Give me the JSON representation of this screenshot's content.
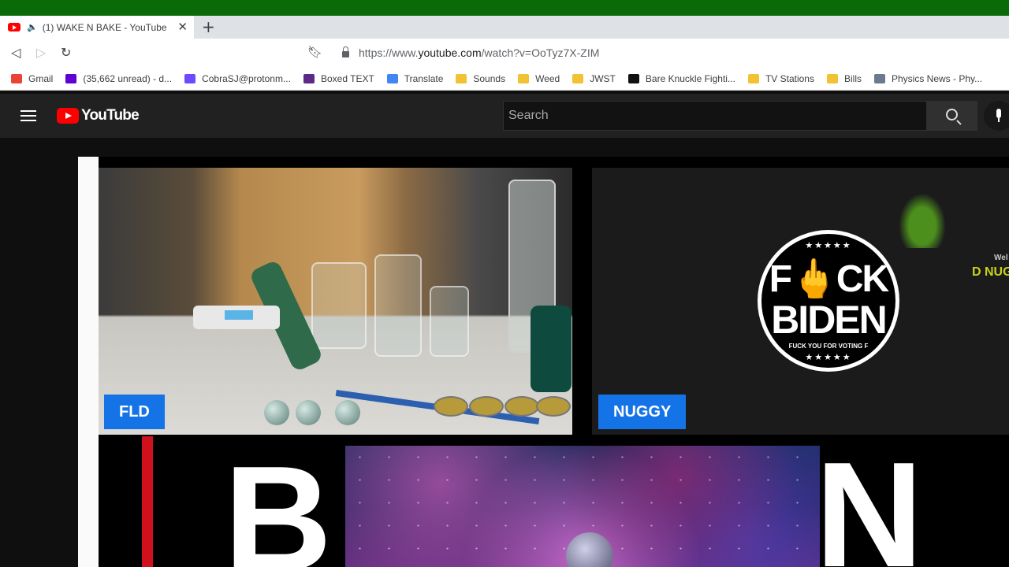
{
  "browser": {
    "tab": {
      "title": "(1) WAKE N BAKE - YouTube",
      "audio_icon": "speaker-icon"
    },
    "address": {
      "scheme": "https://www.",
      "host": "youtube.com",
      "path": "/watch?v=OoTyz7X-ZIM"
    },
    "bookmarks": [
      {
        "label": "Gmail",
        "icon": "gmail-icon",
        "color": "#ea4335"
      },
      {
        "label": "(35,662 unread) - d...",
        "icon": "yahoo-mail-icon",
        "color": "#5f01d1"
      },
      {
        "label": "CobraSJ@protonm...",
        "icon": "proton-icon",
        "color": "#6d4aff"
      },
      {
        "label": "Boxed TEXT",
        "icon": "font-icon",
        "color": "#5b2a86"
      },
      {
        "label": "Translate",
        "icon": "translate-icon",
        "color": "#4285f4"
      },
      {
        "label": "Sounds",
        "icon": "folder-icon",
        "color": "#f1c232"
      },
      {
        "label": "Weed",
        "icon": "folder-icon",
        "color": "#f1c232"
      },
      {
        "label": "JWST",
        "icon": "folder-icon",
        "color": "#f1c232"
      },
      {
        "label": "Bare Knuckle Fighti...",
        "icon": "bkfc-icon",
        "color": "#111111"
      },
      {
        "label": "TV Stations",
        "icon": "folder-icon",
        "color": "#f1c232"
      },
      {
        "label": "Bills",
        "icon": "folder-icon",
        "color": "#f1c232"
      },
      {
        "label": "Physics News - Phy...",
        "icon": "physics-icon",
        "color": "#6b7a8f"
      }
    ]
  },
  "youtube": {
    "logo_text": "YouTube",
    "search_placeholder": "Search"
  },
  "video": {
    "camera1_label": "FLD",
    "camera2_label": "NUGGY",
    "badge": {
      "stars_top": "★★★★★",
      "line1": "F🖕CK",
      "line2": "BIDEN",
      "line3": "FUCK YOU FOR VOTING F",
      "stars_bottom": "★★★★★"
    },
    "side_text_1": "Wel",
    "side_text_2": "D NUG"
  },
  "colors": {
    "accent_green": "#0b6a08",
    "yt_red": "#ff0000",
    "name_tag_blue": "#1473e6"
  }
}
